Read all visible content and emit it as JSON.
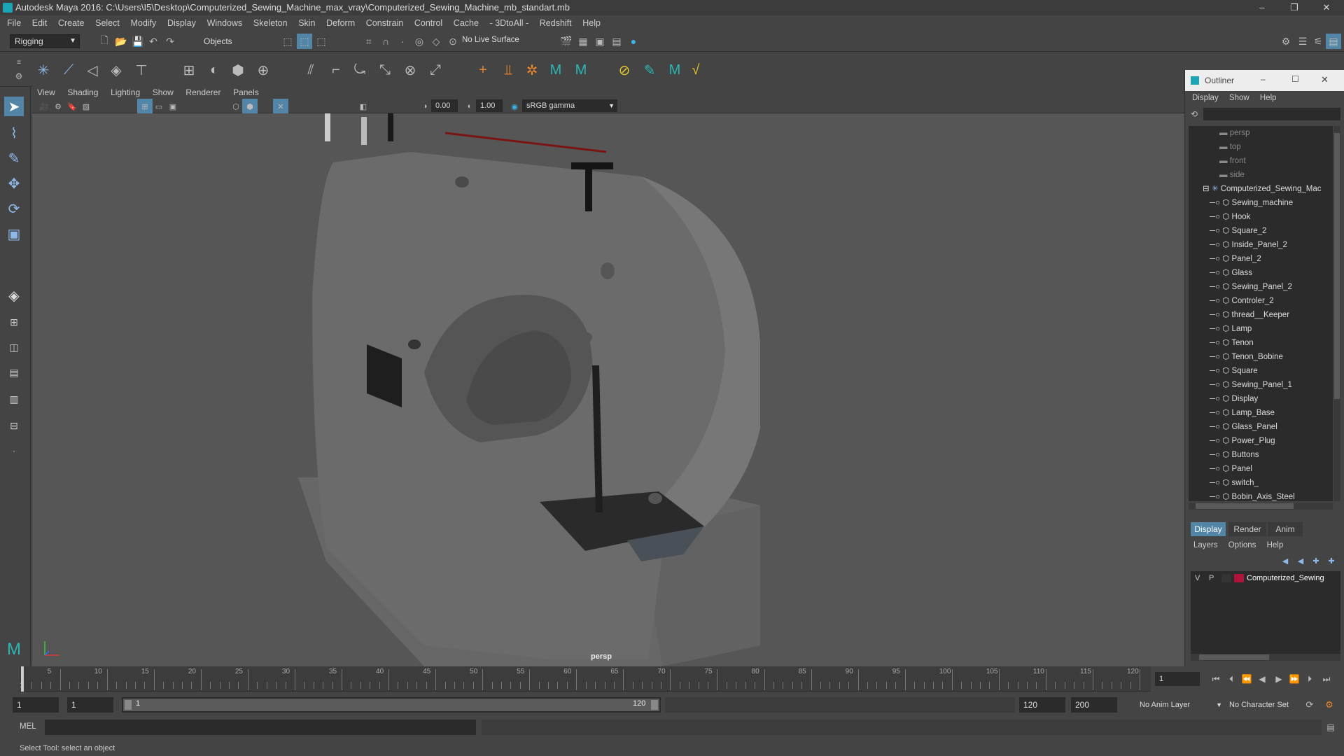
{
  "title": "Autodesk Maya 2016: C:\\Users\\I5\\Desktop\\Computerized_Sewing_Machine_max_vray\\Computerized_Sewing_Machine_mb_standart.mb",
  "menu": [
    "File",
    "Edit",
    "Create",
    "Select",
    "Modify",
    "Display",
    "Windows",
    "Skeleton",
    "Skin",
    "Deform",
    "Constrain",
    "Control",
    "Cache",
    "- 3DtoAll -",
    "Redshift",
    "Help"
  ],
  "status": {
    "mode": "Rigging",
    "objects": "Objects",
    "live_surface": "No Live Surface"
  },
  "viewport": {
    "menu": [
      "View",
      "Shading",
      "Lighting",
      "Show",
      "Renderer",
      "Panels"
    ],
    "exposure": "0.00",
    "gamma": "1.00",
    "color_space": "sRGB gamma",
    "camera_label": "persp"
  },
  "outliner": {
    "title": "Outliner",
    "menu": [
      "Display",
      "Show",
      "Help"
    ],
    "cameras": [
      "persp",
      "top",
      "front",
      "side"
    ],
    "group": "Computerized_Sewing_Mac",
    "items": [
      "Sewing_machine",
      "Hook",
      "Square_2",
      "Inside_Panel_2",
      "Panel_2",
      "Glass",
      "Sewing_Panel_2",
      "Controler_2",
      "thread__Keeper",
      "Lamp",
      "Tenon",
      "Tenon_Bobine",
      "Square",
      "Sewing_Panel_1",
      "Display",
      "Lamp_Base",
      "Glass_Panel",
      "Power_Plug",
      "Buttons",
      "Panel",
      "switch_",
      "Bobin_Axis_Steel"
    ]
  },
  "layers": {
    "tabs": [
      "Display",
      "Render",
      "Anim"
    ],
    "menu": [
      "Layers",
      "Options",
      "Help"
    ],
    "layer": {
      "v": "V",
      "p": "P",
      "name": "Computerized_Sewing",
      "color": "#b0123a"
    }
  },
  "timeline": {
    "ticks": [
      "5",
      "10",
      "15",
      "20",
      "25",
      "30",
      "35",
      "40",
      "45",
      "50",
      "55",
      "60",
      "65",
      "70",
      "75",
      "80",
      "85",
      "90",
      "95",
      "100",
      "105",
      "110",
      "115",
      "120"
    ],
    "start_label": "1",
    "current_frame": "1"
  },
  "range": {
    "start": "1",
    "anim_start": "1",
    "slider_start": "1",
    "slider_end": "120",
    "end": "120",
    "anim_end": "200",
    "anim_layer": "No Anim Layer",
    "char_set": "No Character Set"
  },
  "cmd": {
    "label": "MEL"
  },
  "help_line": "Select Tool: select an object",
  "colors": {
    "accent": "#5285a6",
    "thread": "#7a1414",
    "layer": "#b0123a"
  }
}
